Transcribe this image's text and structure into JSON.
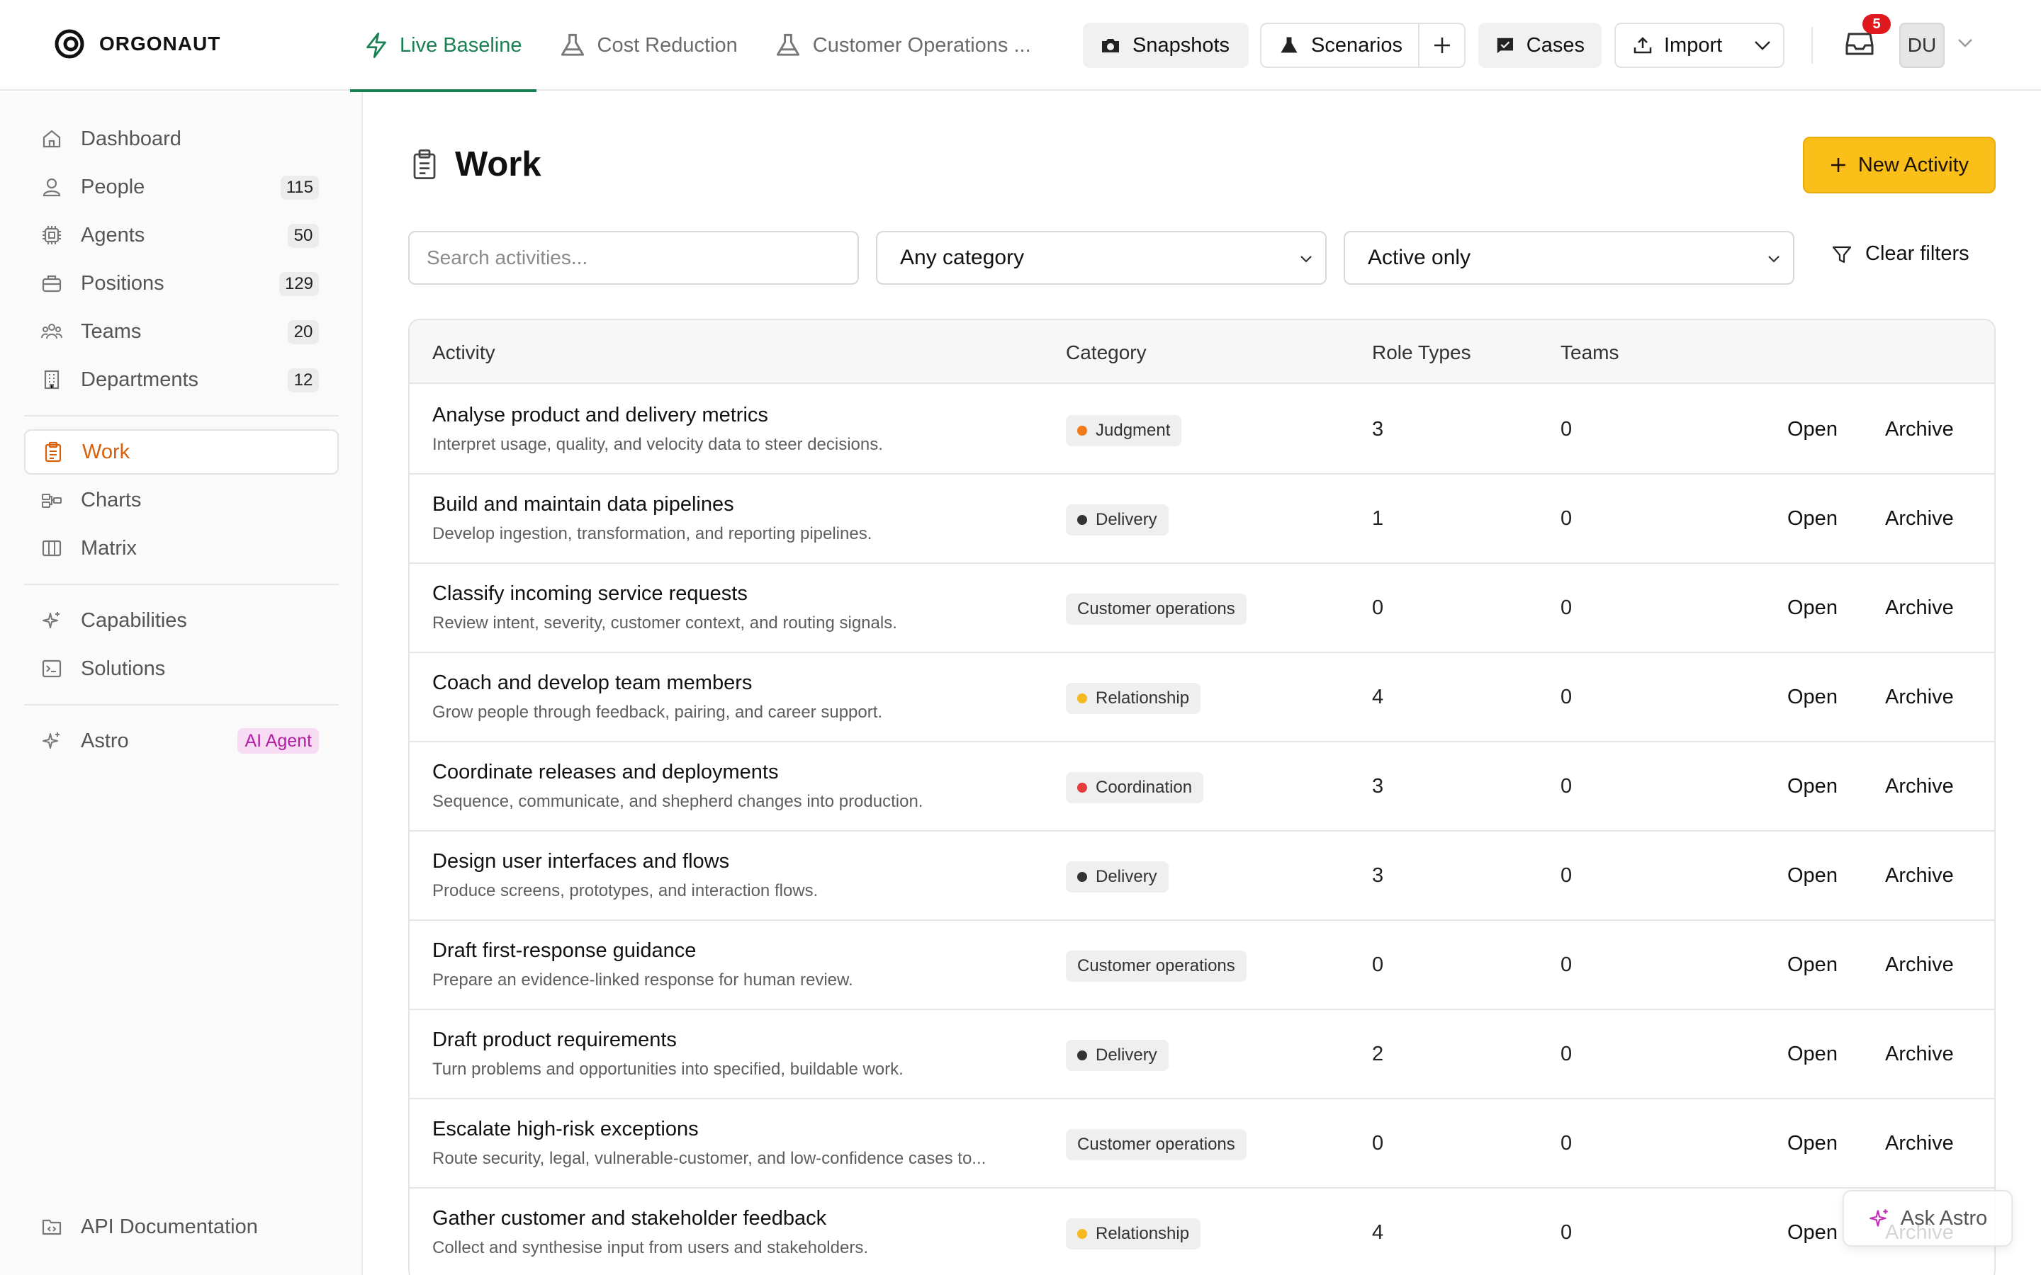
{
  "app": {
    "brand": "ORGONAUT",
    "accent": "#1a7f53",
    "highlight": "#d9600a",
    "primary_button": "#fbbf1a"
  },
  "header": {
    "tabs": [
      {
        "label": "Live Baseline",
        "icon": "lightning-icon",
        "active": true
      },
      {
        "label": "Cost Reduction",
        "icon": "flask-icon",
        "active": false
      },
      {
        "label": "Customer Operations ...",
        "icon": "flask-icon",
        "active": false
      }
    ],
    "tools": {
      "snapshots": "Snapshots",
      "scenarios": "Scenarios",
      "cases": "Cases",
      "import": "Import"
    },
    "inbox_count": "5",
    "avatar_initials": "DU"
  },
  "sidebar": {
    "items": [
      {
        "label": "Dashboard",
        "icon": "home-icon"
      },
      {
        "label": "People",
        "icon": "person-icon",
        "count": "115"
      },
      {
        "label": "Agents",
        "icon": "chip-icon",
        "count": "50"
      },
      {
        "label": "Positions",
        "icon": "briefcase-icon",
        "count": "129"
      },
      {
        "label": "Teams",
        "icon": "team-icon",
        "count": "20"
      },
      {
        "label": "Departments",
        "icon": "building-icon",
        "count": "12"
      },
      {
        "label": "Work",
        "icon": "clipboard-icon",
        "active": true
      },
      {
        "label": "Charts",
        "icon": "org-chart-icon"
      },
      {
        "label": "Matrix",
        "icon": "columns-icon"
      },
      {
        "label": "Capabilities",
        "icon": "sparkle-icon"
      },
      {
        "label": "Solutions",
        "icon": "terminal-icon"
      },
      {
        "label": "Astro",
        "icon": "sparkle-icon",
        "pill": "AI Agent"
      },
      {
        "label": "API Documentation",
        "icon": "folder-code-icon"
      }
    ]
  },
  "main": {
    "title": "Work",
    "new_button": "New Activity",
    "search_placeholder": "Search activities...",
    "category_filter": "Any category",
    "status_filter": "Active only",
    "clear_filters": "Clear filters",
    "table": {
      "headers": {
        "activity": "Activity",
        "category": "Category",
        "role_types": "Role Types",
        "teams": "Teams"
      },
      "open_label": "Open",
      "archive_label": "Archive",
      "rows": [
        {
          "title": "Analyse product and delivery metrics",
          "desc": "Interpret usage, quality, and velocity data to steer decisions.",
          "category": "Judgment",
          "dot": "#f07a1a",
          "role_types": "3",
          "teams": "0"
        },
        {
          "title": "Build and maintain data pipelines",
          "desc": "Develop ingestion, transformation, and reporting pipelines.",
          "category": "Delivery",
          "dot": "#333333",
          "role_types": "1",
          "teams": "0"
        },
        {
          "title": "Classify incoming service requests",
          "desc": "Review intent, severity, customer context, and routing signals.",
          "category": "Customer operations",
          "dot": "",
          "role_types": "0",
          "teams": "0"
        },
        {
          "title": "Coach and develop team members",
          "desc": "Grow people through feedback, pairing, and career support.",
          "category": "Relationship",
          "dot": "#f5b921",
          "role_types": "4",
          "teams": "0"
        },
        {
          "title": "Coordinate releases and deployments",
          "desc": "Sequence, communicate, and shepherd changes into production.",
          "category": "Coordination",
          "dot": "#e53c3c",
          "role_types": "3",
          "teams": "0"
        },
        {
          "title": "Design user interfaces and flows",
          "desc": "Produce screens, prototypes, and interaction flows.",
          "category": "Delivery",
          "dot": "#333333",
          "role_types": "3",
          "teams": "0"
        },
        {
          "title": "Draft first-response guidance",
          "desc": "Prepare an evidence-linked response for human review.",
          "category": "Customer operations",
          "dot": "",
          "role_types": "0",
          "teams": "0"
        },
        {
          "title": "Draft product requirements",
          "desc": "Turn problems and opportunities into specified, buildable work.",
          "category": "Delivery",
          "dot": "#333333",
          "role_types": "2",
          "teams": "0"
        },
        {
          "title": "Escalate high-risk exceptions",
          "desc": "Route security, legal, vulnerable-customer, and low-confidence cases to...",
          "category": "Customer operations",
          "dot": "",
          "role_types": "0",
          "teams": "0"
        },
        {
          "title": "Gather customer and stakeholder feedback",
          "desc": "Collect and synthesise input from users and stakeholders.",
          "category": "Relationship",
          "dot": "#f5b921",
          "role_types": "4",
          "teams": "0"
        }
      ]
    },
    "ask_astro": "Ask Astro"
  }
}
